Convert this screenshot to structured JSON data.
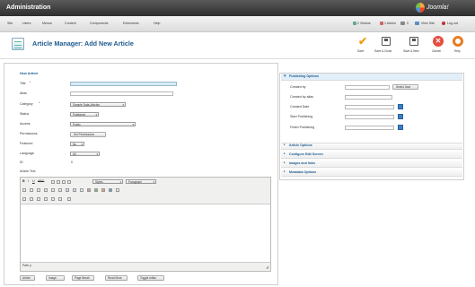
{
  "header": {
    "title": "Administration",
    "logo_text": "Joomla!"
  },
  "menu": [
    {
      "label": "Site"
    },
    {
      "label": "Users"
    },
    {
      "label": "Menus"
    },
    {
      "label": "Content"
    },
    {
      "label": "Components"
    },
    {
      "label": "Extensions"
    },
    {
      "label": "Help"
    }
  ],
  "status": {
    "visitors": "2 Visitors",
    "admin": "1 Admin",
    "messages": "0",
    "view_site": "View Site",
    "logout": "Log out"
  },
  "page": {
    "title": "Article Manager: Add New Article"
  },
  "toolbar": [
    {
      "label": "Save",
      "icon": "check-icon",
      "color": "#f39c12"
    },
    {
      "label": "Save & Close",
      "icon": "save-close-icon",
      "color": "#555555"
    },
    {
      "label": "Save & New",
      "icon": "save-new-icon",
      "color": "#555555"
    },
    {
      "label": "Cancel",
      "icon": "cancel-icon",
      "color": "#e74c3c"
    },
    {
      "label": "Help",
      "icon": "help-icon",
      "color": "#e67e22"
    }
  ],
  "form": {
    "legend": "New Article",
    "title_label": "Title",
    "alias_label": "Alias",
    "category_label": "Category",
    "category_value": "Sample Data-Articles",
    "status_label": "Status",
    "status_value": "Published",
    "access_label": "Access",
    "access_value": "Public",
    "permissions_label": "Permissions",
    "permissions_button": "Set Permissions",
    "featured_label": "Featured",
    "featured_value": "No",
    "language_label": "Language",
    "language_value": "All",
    "id_label": "ID",
    "id_value": "0",
    "article_text_label": "Article Text"
  },
  "editor": {
    "styles_value": "Styles",
    "font_value": "Paragraph",
    "path_label": "Path: p"
  },
  "bottom_buttons": [
    {
      "label": "Article"
    },
    {
      "label": "Image"
    },
    {
      "label": "Page Break"
    },
    {
      "label": "Read More"
    },
    {
      "label": "Toggle editor"
    }
  ],
  "sidebar": {
    "publishing_options": "Publishing Options",
    "created_by": "Created by",
    "select_user": "Select User",
    "created_by_alias": "Created by alias",
    "created_date": "Created Date",
    "start_publishing": "Start Publishing",
    "finish_publishing": "Finish Publishing",
    "sections": [
      {
        "label": "Article Options"
      },
      {
        "label": "Configure Edit Screen"
      },
      {
        "label": "Images and links"
      },
      {
        "label": "Metadata Options"
      }
    ]
  }
}
